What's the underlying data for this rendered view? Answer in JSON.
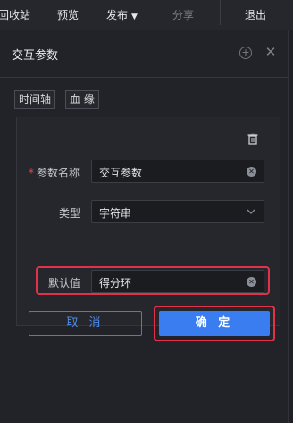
{
  "toolbar": {
    "recycle_label": "回收站",
    "preview_label": "预览",
    "publish_label": "发布",
    "share_label": "分享",
    "exit_label": "退出"
  },
  "panel": {
    "title": "交互参数",
    "tabs": [
      {
        "label": "时间轴"
      },
      {
        "label": "血 缘"
      }
    ],
    "form": {
      "name_label": "参数名称",
      "name_value": "交互参数",
      "type_label": "类型",
      "type_value": "字符串",
      "default_label": "默认值",
      "default_value": "得分环"
    },
    "cancel_label": "取 消",
    "ok_label": "确 定"
  },
  "colors": {
    "accent": "#3a7df0",
    "highlight": "#e0334a",
    "required": "#e5484d"
  }
}
